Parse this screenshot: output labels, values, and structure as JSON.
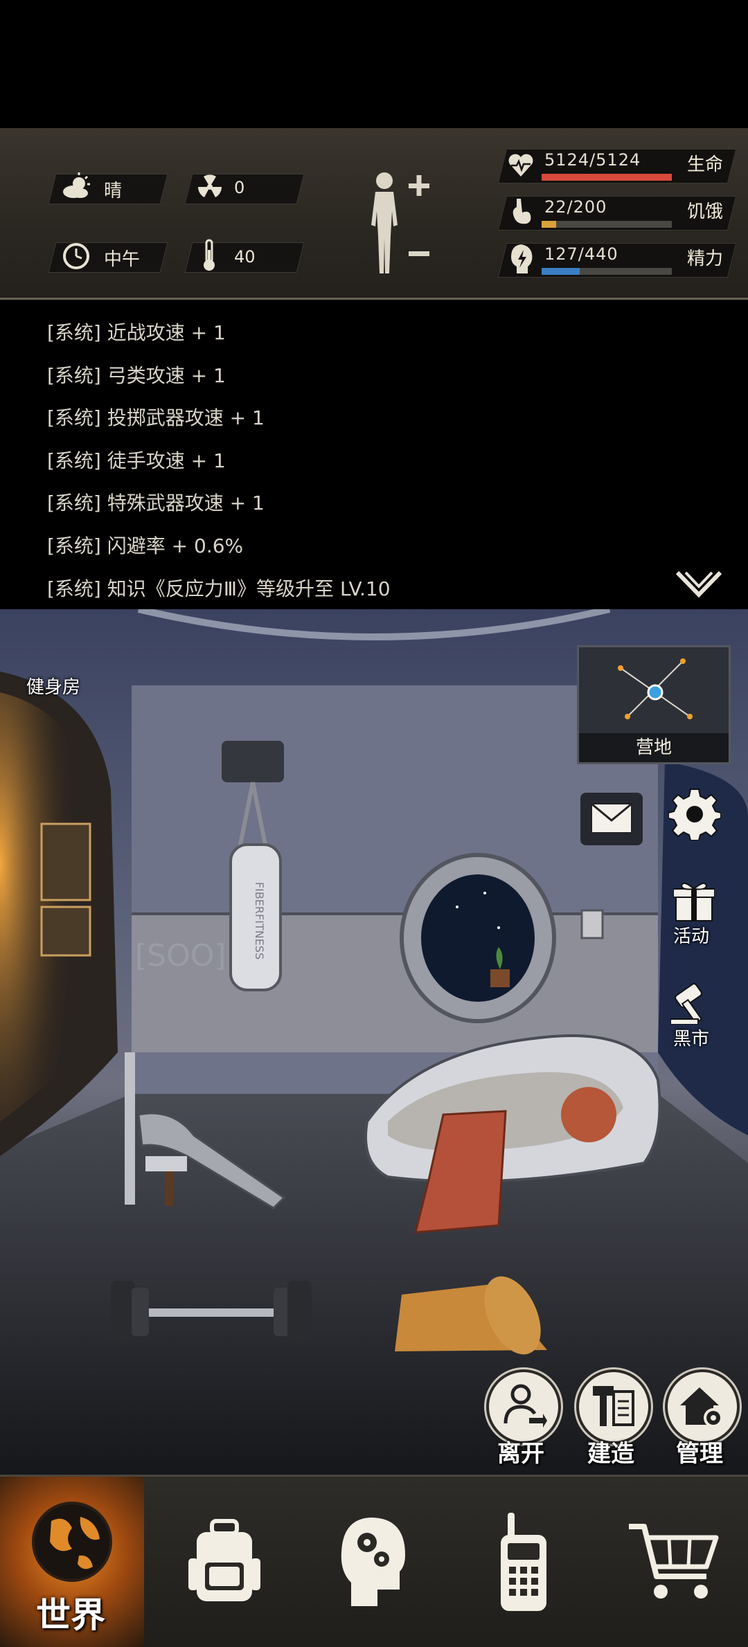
{
  "status": {
    "weather": "晴",
    "radiation": "0",
    "time_of_day": "中午",
    "temperature": "40",
    "health": {
      "label": "生命",
      "value": "5124/5124",
      "fraction": 1.0,
      "color": "#d9493b"
    },
    "hunger": {
      "label": "饥饿",
      "value": "22/200",
      "fraction": 0.11,
      "color": "#d9a23a"
    },
    "energy": {
      "label": "精力",
      "value": "127/440",
      "fraction": 0.29,
      "color": "#3b7ec4"
    }
  },
  "log": [
    "[系统] 近战攻速 + 1",
    "[系统] 弓类攻速 + 1",
    "[系统] 投掷武器攻速 + 1",
    "[系统] 徒手攻速 + 1",
    "[系统] 特殊武器攻速 + 1",
    "[系统] 闪避率 + 0.6%",
    "[系统] 知识《反应力Ⅲ》等级升至 LV.10"
  ],
  "scene": {
    "room_name": "健身房",
    "minimap_label": "营地",
    "side_buttons": {
      "event": "活动",
      "black_market": "黑市"
    },
    "actions": {
      "leave": "离开",
      "build": "建造",
      "manage": "管理"
    },
    "bag_brand": "SOO"
  },
  "nav": {
    "world": "世界"
  },
  "icons": [
    "sun-cloud-icon",
    "radiation-icon",
    "clock-icon",
    "thermometer-icon",
    "body-icon",
    "heart-icon",
    "stomach-icon",
    "energy-icon",
    "collapse-chevron-icon",
    "mail-icon",
    "gear-icon",
    "gift-icon",
    "gavel-icon",
    "person-exit-icon",
    "hammer-icon",
    "house-gear-icon",
    "globe-icon",
    "backpack-icon",
    "brain-icon",
    "radio-icon",
    "cart-icon"
  ]
}
